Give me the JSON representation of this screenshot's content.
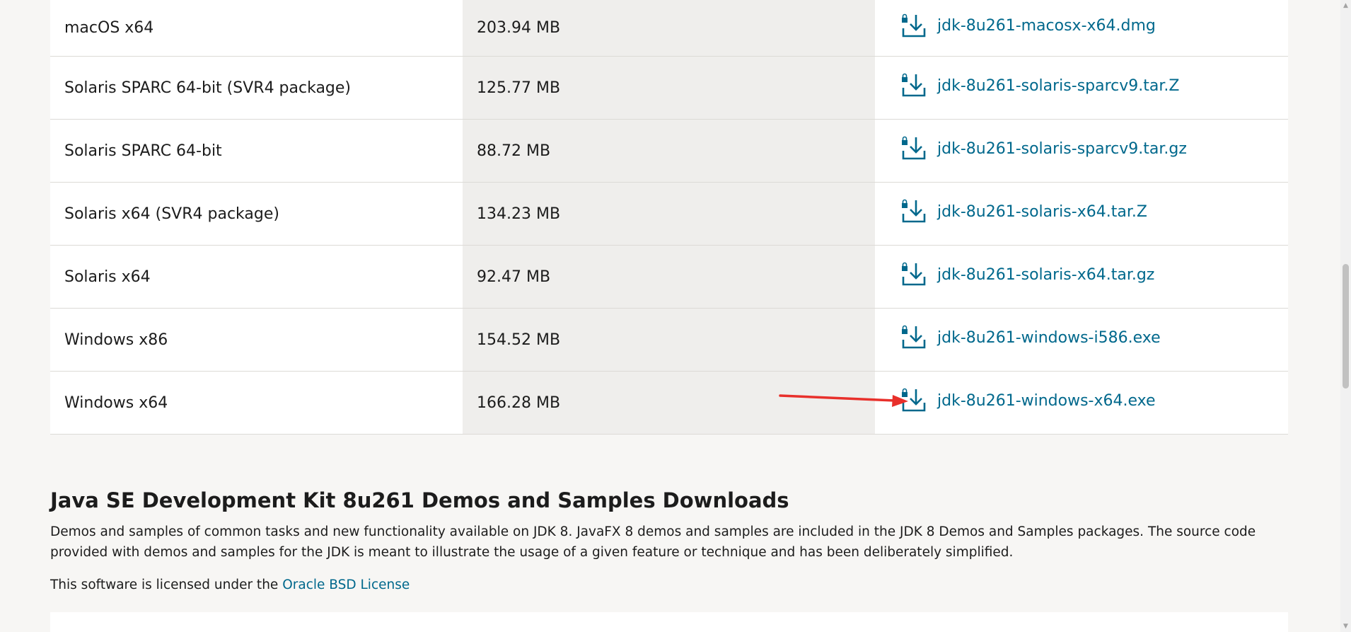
{
  "downloads": [
    {
      "product": "macOS x64",
      "size": "203.94 MB",
      "file": "jdk-8u261-macosx-x64.dmg"
    },
    {
      "product": "Solaris SPARC 64-bit (SVR4 package)",
      "size": "125.77 MB",
      "file": "jdk-8u261-solaris-sparcv9.tar.Z"
    },
    {
      "product": "Solaris SPARC 64-bit",
      "size": "88.72 MB",
      "file": "jdk-8u261-solaris-sparcv9.tar.gz"
    },
    {
      "product": "Solaris x64 (SVR4 package)",
      "size": "134.23 MB",
      "file": "jdk-8u261-solaris-x64.tar.Z"
    },
    {
      "product": "Solaris x64",
      "size": "92.47 MB",
      "file": "jdk-8u261-solaris-x64.tar.gz"
    },
    {
      "product": "Windows x86",
      "size": "154.52 MB",
      "file": "jdk-8u261-windows-i586.exe"
    },
    {
      "product": "Windows x64",
      "size": "166.28 MB",
      "file": "jdk-8u261-windows-x64.exe"
    }
  ],
  "demos_section": {
    "title": "Java SE Development Kit 8u261 Demos and Samples Downloads",
    "description": "Demos and samples of common tasks and new functionality available on JDK 8. JavaFX 8 demos and samples are included in the JDK 8 Demos and Samples packages. The source code provided with demos and samples for the JDK is meant to illustrate the usage of a given feature or technique and has been deliberately simplified.",
    "license_prefix": "This software is licensed under the ",
    "license_link": "Oracle BSD License"
  },
  "icons": {
    "download": "download-lock-icon"
  },
  "colors": {
    "link": "#00688c",
    "annotation": "#e8302b",
    "background": "#f7f6f4",
    "size_column": "#efeeec"
  }
}
